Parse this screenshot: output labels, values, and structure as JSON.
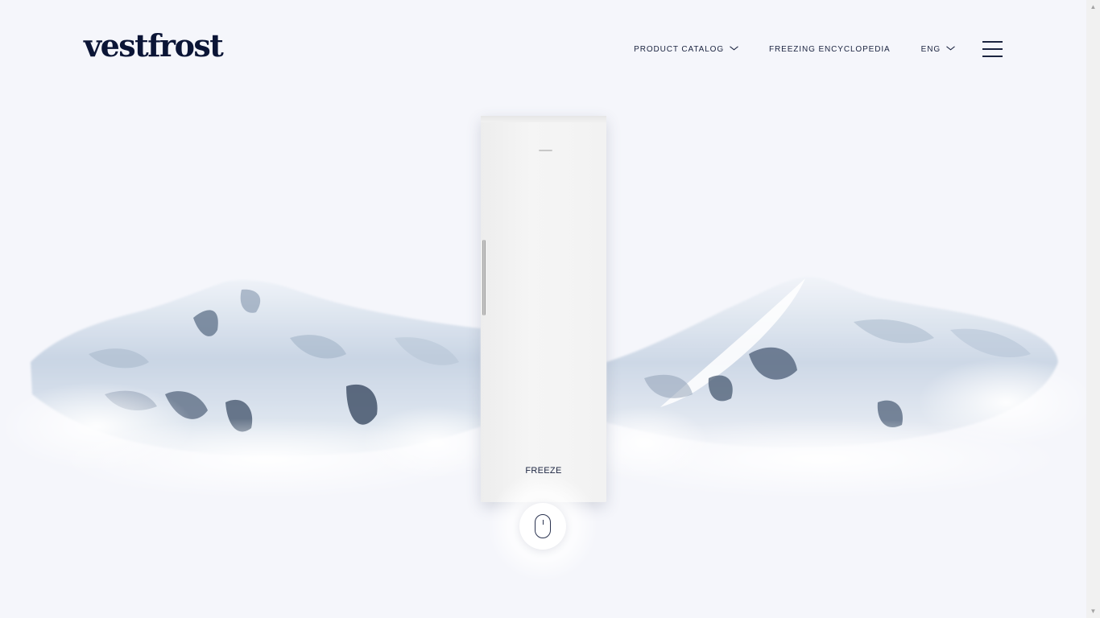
{
  "brand": {
    "logo_text": "vestfrost"
  },
  "nav": {
    "items": [
      {
        "label": "PRODUCT CATALOG",
        "has_dropdown": true
      },
      {
        "label": "FREEZING ENCYCLOPEDIA",
        "has_dropdown": false
      },
      {
        "label": "ENG",
        "has_dropdown": true
      }
    ],
    "menu_icon": "hamburger-icon"
  },
  "hero": {
    "product_label": "FREEZE",
    "scroll_icon": "mouse-scroll-icon"
  },
  "colors": {
    "background": "#f5f6fb",
    "text": "#1b2440",
    "logo": "#0b1536"
  }
}
